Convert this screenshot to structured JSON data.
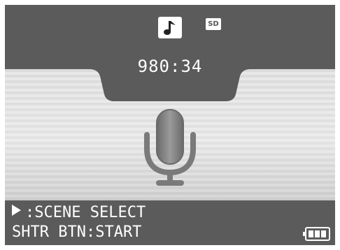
{
  "status": {
    "mode_icon": "music-note-icon",
    "media_icon": "sd-card-icon",
    "media_label": "SD",
    "remaining_time": "980:34"
  },
  "center_icon": "microphone-icon",
  "hints": {
    "scene_select_icon": "play-triangle-icon",
    "scene_select": ":SCENE SELECT",
    "shutter_start": "SHTR BTN:START"
  },
  "battery_icon": "battery-icon",
  "colors": {
    "panel_dark": "#5b5b5b",
    "background_gray": "#7d7d7d",
    "text": "#ffffff"
  }
}
